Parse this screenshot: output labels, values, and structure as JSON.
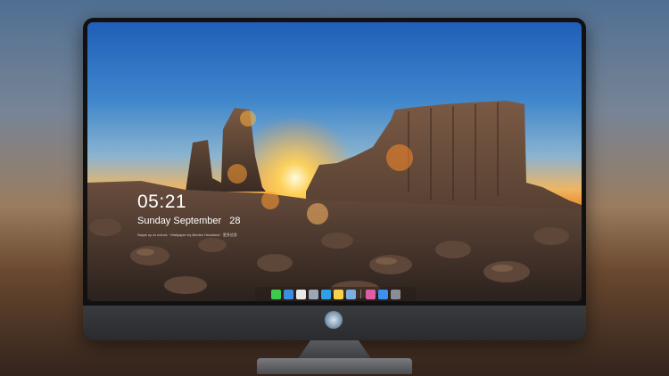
{
  "lock_screen": {
    "time": "05:21",
    "date_weekday": "Sunday September",
    "date_day": "28",
    "hint": "Swipe up to unlock · Wallpaper by Bombo Headland · 更多信息"
  },
  "dock": {
    "icons": [
      {
        "name": "messages-icon",
        "color": "#3ccb4f"
      },
      {
        "name": "finder-icon",
        "color": "#3c8fe0"
      },
      {
        "name": "safari-icon",
        "color": "#e8e8e8"
      },
      {
        "name": "launchpad-icon",
        "color": "#9aa7b7"
      },
      {
        "name": "clips-icon",
        "color": "#2ea0e8"
      },
      {
        "name": "notes-icon",
        "color": "#f4d34a"
      },
      {
        "name": "photos-icon",
        "color": "#7bb0e0"
      },
      {
        "name": "itunes-icon",
        "color": "#e05ca7"
      },
      {
        "name": "app-store-icon",
        "color": "#3d8ff0"
      },
      {
        "name": "camera-icon",
        "color": "#8a8f96"
      }
    ]
  }
}
